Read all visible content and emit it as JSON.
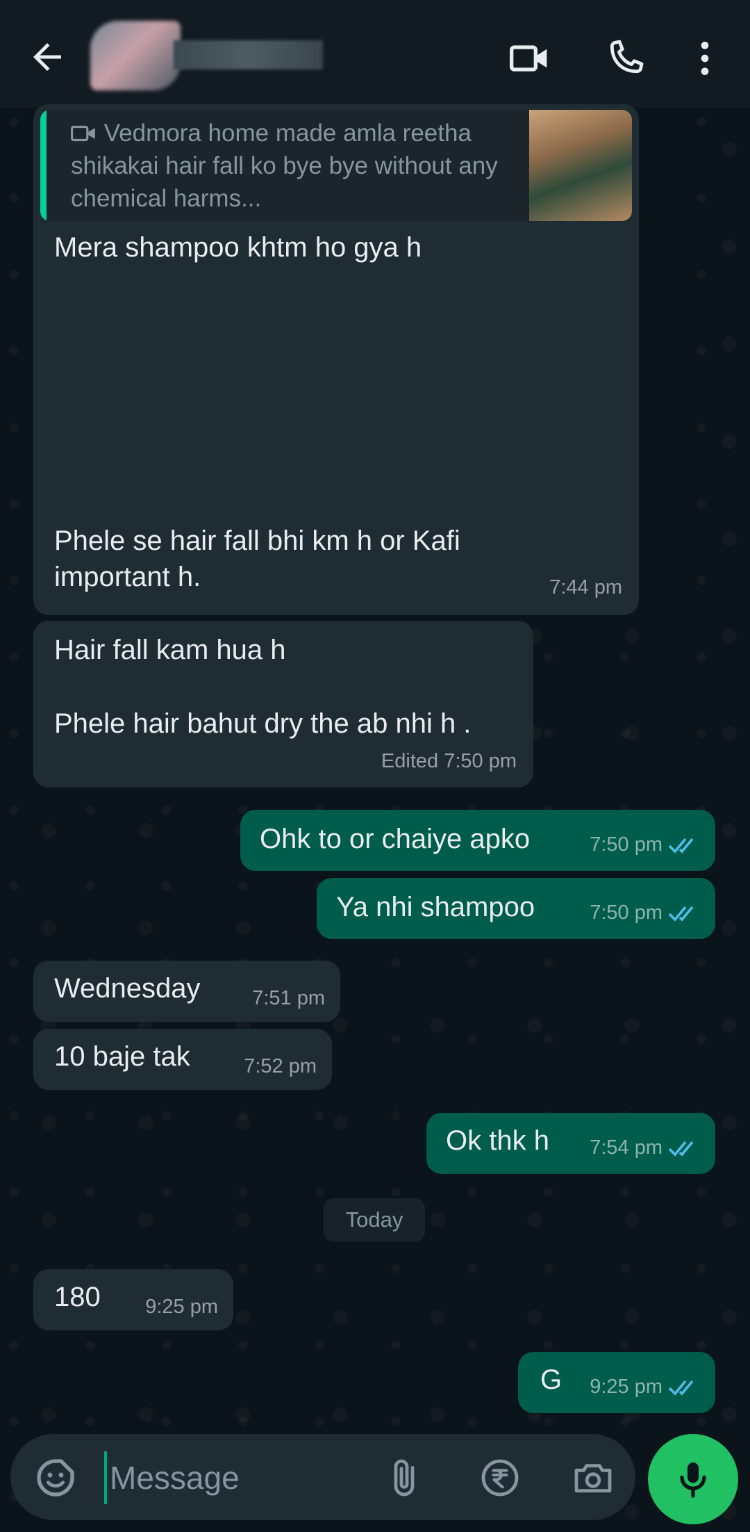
{
  "header": {
    "contact_name": "",
    "icons": [
      "back-arrow-icon",
      "video-call-icon",
      "voice-call-icon",
      "more-options-icon"
    ]
  },
  "messages": [
    {
      "direction": "incoming",
      "quote": {
        "icon": "video-icon",
        "text": "Vedmora home made amla reetha shikakai hair fall ko bye bye without any chemical harms..."
      },
      "line1": "Mera shampoo khtm ho gya h",
      "line2": "Phele  se hair fall bhi  km h or Kafi important h.",
      "time": "7:44 pm"
    },
    {
      "direction": "incoming",
      "line1": "Hair fall kam hua h",
      "line2": "Phele hair bahut dry the ab nhi h .",
      "edited": "Edited",
      "time": "7:50 pm"
    },
    {
      "direction": "outgoing",
      "text": "Ohk to or chaiye apko",
      "time": "7:50 pm",
      "status": "read"
    },
    {
      "direction": "outgoing",
      "text": "Ya nhi shampoo",
      "time": "7:50 pm",
      "status": "read"
    },
    {
      "direction": "incoming",
      "text": "Wednesday",
      "time": "7:51 pm"
    },
    {
      "direction": "incoming",
      "text": "10 baje tak",
      "time": "7:52 pm"
    },
    {
      "direction": "outgoing",
      "text": "Ok thk h",
      "time": "7:54 pm",
      "status": "read"
    },
    {
      "direction": "incoming",
      "text": "180",
      "time": "9:25 pm"
    },
    {
      "direction": "outgoing",
      "text": "G",
      "time": "9:25 pm",
      "status": "read"
    }
  ],
  "date_separator": "Today",
  "input": {
    "placeholder": "Message",
    "icons": [
      "emoji-sticker-icon",
      "attach-icon",
      "rupee-payment-icon",
      "camera-icon",
      "mic-icon"
    ]
  },
  "colors": {
    "background": "#0b141a",
    "header": "#121b21",
    "incoming_bubble": "#202c33",
    "outgoing_bubble": "#005c4b",
    "read_ticks": "#53bdeb",
    "accent": "#00a884",
    "mic_button": "#21c063"
  }
}
